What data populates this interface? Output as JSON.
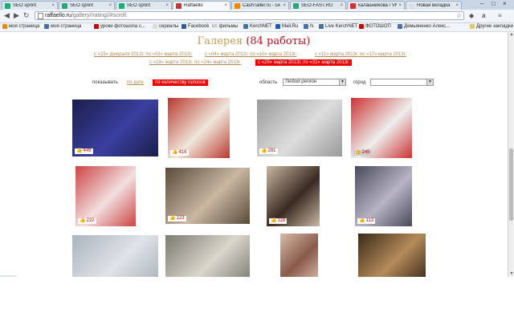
{
  "browser": {
    "tabs": [
      {
        "title": "SEO sprint",
        "active": false,
        "fav": "#2a7"
      },
      {
        "title": "SEO sprint",
        "active": false,
        "fav": "#2a7"
      },
      {
        "title": "SEO sprint",
        "active": false,
        "fav": "#2a7"
      },
      {
        "title": "Raffaello",
        "active": true,
        "fav": "#c33"
      },
      {
        "title": "CashTaller.ru - си",
        "active": false,
        "fav": "#e80"
      },
      {
        "title": "SEO-FAST.RU",
        "active": false,
        "fav": "#2a7"
      },
      {
        "title": "калашникова / VK",
        "active": false,
        "fav": "#c33"
      },
      {
        "title": "Новая вкладка",
        "active": false,
        "fav": "#ddd"
      }
    ],
    "url_domain": "raffaello.ru",
    "url_path": "/gallery//rating//#scroll",
    "bookmarks": [
      {
        "label": "моя страница",
        "color": "#e80"
      },
      {
        "label": "моя страница",
        "color": "#4a6fa5"
      },
      {
        "label": "уроки фотошопа с...",
        "color": "#c00"
      },
      {
        "label": "сериалы",
        "color": "#ddd"
      },
      {
        "label": "Facebook",
        "color": "#3b5998"
      },
      {
        "label": "фильмы",
        "color": "#888"
      },
      {
        "label": "KerchNET",
        "color": "#4a6fa5"
      },
      {
        "label": "Mail.Ru",
        "color": "#1a5fb4"
      },
      {
        "label": "fs",
        "color": "#4a6fa5"
      },
      {
        "label": "Live KerchNET",
        "color": "#4a6fa5"
      },
      {
        "label": "ФОТОШОП",
        "color": "#c00"
      },
      {
        "label": "Демьяненко Алекс...",
        "color": "#4a6fa5"
      }
    ],
    "other_bookmarks": "Другие закладки",
    "bookmark_prefix_ek": "EK",
    "window_controls": {
      "minimize": "–",
      "maximize": "□",
      "close": "×"
    }
  },
  "page": {
    "title_main": "Галерея ",
    "title_count": "(84 работы)",
    "periods": [
      {
        "label": "с «25» февраля 2013г. по «03» марта 2013г.",
        "selected": false
      },
      {
        "label": "с «04» марта 2013г. по «10» марта 2013г.",
        "selected": false
      },
      {
        "label": "с «11» марта 2013г. по «17» марта 2013г.",
        "selected": false
      },
      {
        "label": "с «18» марта 2013г. по «24» марта 2013г.",
        "selected": false
      },
      {
        "label": "с «25» марта 2013г. по «31» марта 2013г.",
        "selected": true
      }
    ],
    "filters": {
      "show_label": "показывать",
      "by_date": "по дате",
      "by_votes": "по количеству голосов",
      "region_label": "область",
      "region_value": "Любой регион",
      "city_label": "город",
      "city_value": ""
    },
    "photos": [
      {
        "votes": "449",
        "colors": [
          "#1a1e4a",
          "#3b3fa0"
        ]
      },
      {
        "votes": "416",
        "colors": [
          "#b83a2e",
          "#f0e7dc"
        ]
      },
      {
        "votes": "281",
        "colors": [
          "#999",
          "#ddd"
        ]
      },
      {
        "votes": "245",
        "colors": [
          "#c33",
          "#eee"
        ]
      },
      {
        "votes": "222",
        "colors": [
          "#c44",
          "#f2dfe0"
        ]
      },
      {
        "votes": "123",
        "colors": [
          "#5a4a3a",
          "#c9b7a2"
        ]
      },
      {
        "votes": "118",
        "colors": [
          "#c9b7a2",
          "#3a2a22"
        ]
      },
      {
        "votes": "113",
        "colors": [
          "#4a4a5a",
          "#b7b3c5"
        ]
      },
      {
        "votes": "",
        "colors": [
          "#aab3bc",
          "#e0e3e8"
        ]
      },
      {
        "votes": "",
        "colors": [
          "#7b7b70",
          "#d9d6cc"
        ]
      },
      {
        "votes": "",
        "colors": [
          "#d7b9a9",
          "#8a5a4a"
        ]
      },
      {
        "votes": "",
        "colors": [
          "#3a2a1a",
          "#b58a5a"
        ]
      }
    ]
  }
}
